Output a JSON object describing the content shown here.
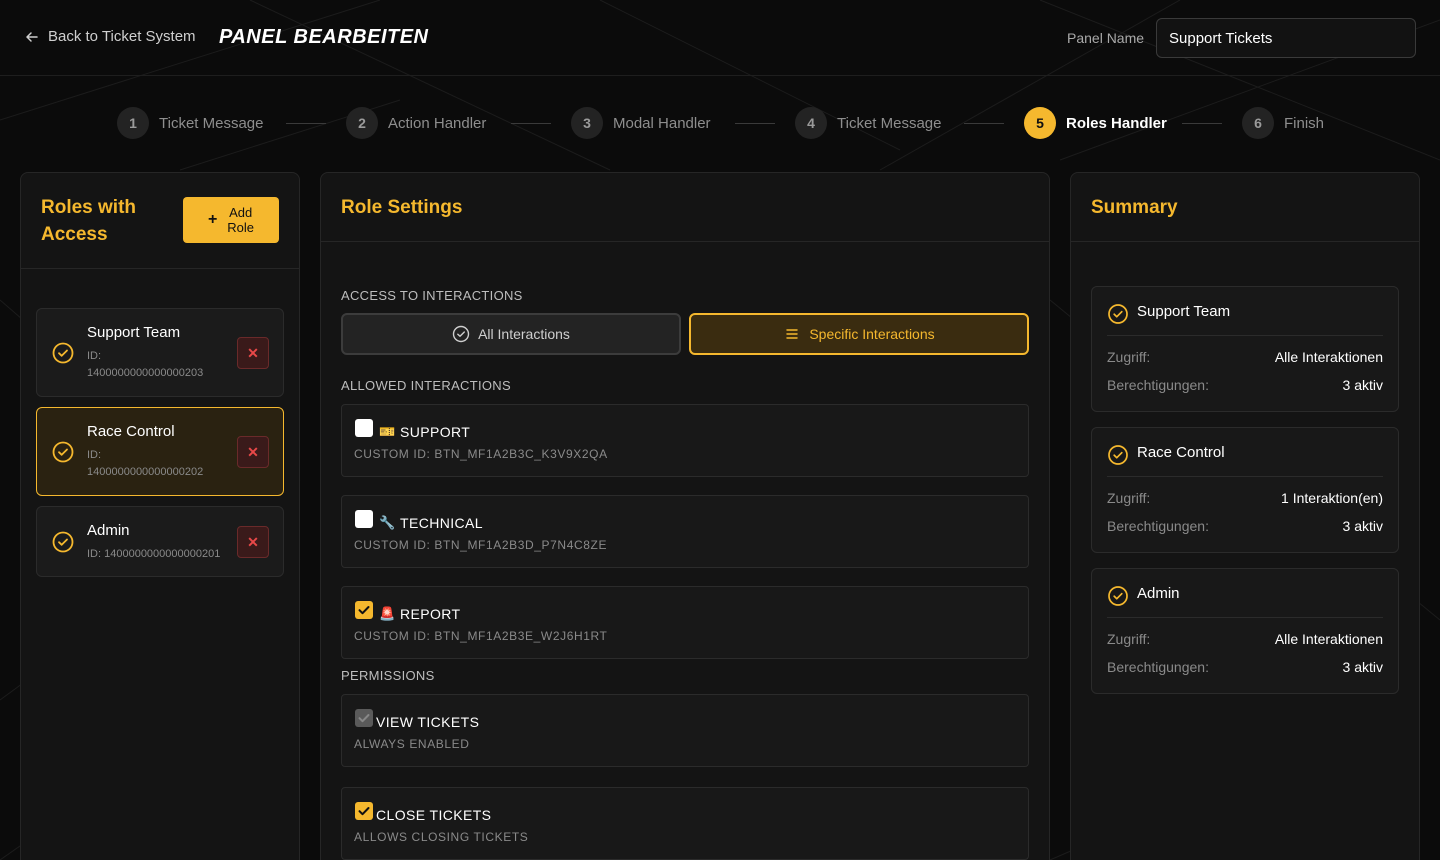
{
  "header": {
    "back_label": "Back to Ticket System",
    "title": "PANEL BEARBEITEN",
    "panel_name_label": "Panel Name",
    "panel_name_value": "Support Tickets"
  },
  "steps": [
    {
      "num": "1",
      "label": "Ticket Message"
    },
    {
      "num": "2",
      "label": "Action Handler"
    },
    {
      "num": "3",
      "label": "Modal Handler"
    },
    {
      "num": "4",
      "label": "Ticket Message"
    },
    {
      "num": "5",
      "label": "Roles Handler",
      "active": true
    },
    {
      "num": "6",
      "label": "Finish"
    }
  ],
  "roles_panel": {
    "title_line1": "Roles with",
    "title_line2": "Access",
    "add_plus": "+",
    "add_line1": "Add",
    "add_line2": "Role",
    "delete_symbol": "✕",
    "roles": [
      {
        "name": "Support Team",
        "id_prefix": "ID:",
        "id": "1400000000000000203"
      },
      {
        "name": "Race Control",
        "id_prefix": "ID:",
        "id": "1400000000000000202",
        "selected": true
      },
      {
        "name": "Admin",
        "id_full": "ID: 1400000000000000201"
      }
    ]
  },
  "settings_panel": {
    "title": "Role Settings",
    "access_label": "ACCESS TO INTERACTIONS",
    "all_interactions": "All Interactions",
    "specific_interactions": "Specific Interactions",
    "allowed_label": "ALLOWED INTERACTIONS",
    "interactions": [
      {
        "emoji": "🎫",
        "title": "SUPPORT",
        "sub": "CUSTOM ID: BTN_MF1A2B3C_K3V9X2QA",
        "checked": false
      },
      {
        "emoji": "🔧",
        "title": "TECHNICAL",
        "sub": "CUSTOM ID: BTN_MF1A2B3D_P7N4C8ZE",
        "checked": false
      },
      {
        "emoji": "🚨",
        "title": "REPORT",
        "sub": "CUSTOM ID: BTN_MF1A2B3E_W2J6H1RT",
        "checked": true
      }
    ],
    "permissions_label": "PERMISSIONS",
    "permissions": [
      {
        "title": "VIEW TICKETS",
        "sub": "ALWAYS ENABLED",
        "state": "disabled"
      },
      {
        "title": "CLOSE TICKETS",
        "sub": "ALLOWS CLOSING TICKETS",
        "state": "checked"
      }
    ]
  },
  "summary_panel": {
    "title": "Summary",
    "access_key": "Zugriff:",
    "perm_key": "Berechtigungen:",
    "items": [
      {
        "name": "Support Team",
        "access": "Alle Interaktionen",
        "perms": "3 aktiv"
      },
      {
        "name": "Race Control",
        "access": "1 Interaktion(en)",
        "perms": "3 aktiv"
      },
      {
        "name": "Admin",
        "access": "Alle Interaktionen",
        "perms": "3 aktiv"
      }
    ]
  },
  "colors": {
    "accent": "#f5b82e",
    "background": "#0b0b0b",
    "panel": "#141414",
    "danger": "#e84848"
  },
  "icons": {
    "back": "arrow-left-icon",
    "role_check": "check-circle-icon",
    "delete": "close-icon",
    "all_interactions": "check-circle-icon",
    "specific_interactions": "list-icon"
  }
}
